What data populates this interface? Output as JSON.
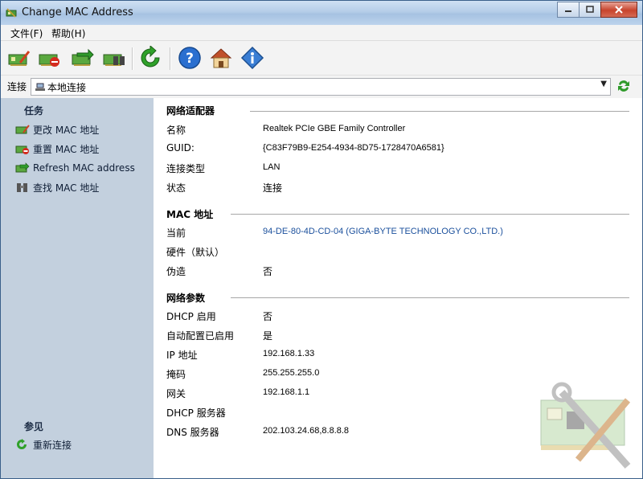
{
  "window": {
    "title": "Change MAC Address",
    "min": "0",
    "max": "1",
    "close": "r"
  },
  "menu": {
    "file": "文件(F)",
    "help": "帮助(H)"
  },
  "connection": {
    "label": "连接",
    "selected": "本地连接"
  },
  "sidebar": {
    "tasks_title": "任务",
    "tasks": [
      {
        "label": "更改 MAC 地址"
      },
      {
        "label": "重置 MAC 地址"
      },
      {
        "label": "Refresh MAC address"
      },
      {
        "label": "查找 MAC 地址"
      }
    ],
    "see_also_title": "参见",
    "see_also": [
      {
        "label": "重新连接"
      }
    ]
  },
  "sections": {
    "adapter": {
      "title": "网络适配器",
      "rows": [
        {
          "label": "名称",
          "value": "Realtek PCIe GBE Family Controller"
        },
        {
          "label": "GUID:",
          "value": "{C83F79B9-E254-4934-8D75-1728470A6581}"
        },
        {
          "label": "连接类型",
          "value": "LAN"
        },
        {
          "label": "状态",
          "value": "连接"
        }
      ]
    },
    "mac": {
      "title": "MAC 地址",
      "rows": [
        {
          "label": "当前",
          "value": "94-DE-80-4D-CD-04 (GIGA-BYTE TECHNOLOGY CO.,LTD.)"
        },
        {
          "label": "硬件（默认）",
          "value": ""
        },
        {
          "label": "伪造",
          "value": "否"
        }
      ]
    },
    "params": {
      "title": "网络参数",
      "rows": [
        {
          "label": "DHCP 启用",
          "value": "否"
        },
        {
          "label": "自动配置已启用",
          "value": "是"
        },
        {
          "label": "IP 地址",
          "value": "192.168.1.33"
        },
        {
          "label": "掩码",
          "value": "255.255.255.0"
        },
        {
          "label": "网关",
          "value": "192.168.1.1"
        },
        {
          "label": "DHCP 服务器",
          "value": ""
        },
        {
          "label": "DNS 服务器",
          "value": "202.103.24.68,8.8.8.8"
        }
      ]
    }
  },
  "icons": {
    "toolbar": [
      "change-mac-icon",
      "reset-mac-icon",
      "refresh-mac-icon",
      "find-mac-icon",
      "reconnect-icon",
      "help-icon",
      "home-icon",
      "info-icon"
    ]
  },
  "colors": {
    "sidebar_bg": "#c3d0de",
    "link": "#1a4f9c",
    "accent_green": "#2f9a2a"
  }
}
